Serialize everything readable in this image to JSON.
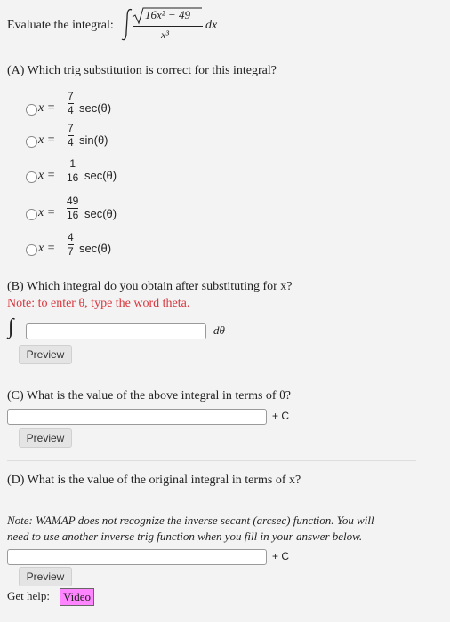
{
  "header": {
    "prompt": "Evaluate the integral:",
    "numerator": "16x² − 49",
    "denominator": "x³",
    "differential": "dx"
  },
  "partA": {
    "question": "(A) Which trig substitution is correct for this integral?",
    "var": "x",
    "eq": "=",
    "options": [
      {
        "num": "7",
        "den": "4",
        "func": "sec(θ)"
      },
      {
        "num": "7",
        "den": "4",
        "func": "sin(θ)"
      },
      {
        "num": "1",
        "den": "16",
        "func": "sec(θ)"
      },
      {
        "num": "49",
        "den": "16",
        "func": "sec(θ)"
      },
      {
        "num": "4",
        "den": "7",
        "func": "sec(θ)"
      }
    ]
  },
  "partB": {
    "question": "(B) Which integral do you obtain after substituting for x?",
    "note": "Note: to enter θ, type the word theta.",
    "integral_sign": "∫",
    "differential": "dθ",
    "preview": "Preview"
  },
  "partC": {
    "question": "(C) What is the value of the above integral in terms of θ?",
    "suffix": "+ C",
    "preview": "Preview"
  },
  "partD": {
    "question": "(D) What is the value of the original integral in terms of x?",
    "note_line1": "Note: WAMAP does not recognize the inverse secant (arcsec) function. You will",
    "note_line2": "need to use another inverse trig function when you fill in your answer below.",
    "suffix": "+ C",
    "preview": "Preview"
  },
  "help": {
    "label": "Get help:",
    "video": "Video"
  }
}
